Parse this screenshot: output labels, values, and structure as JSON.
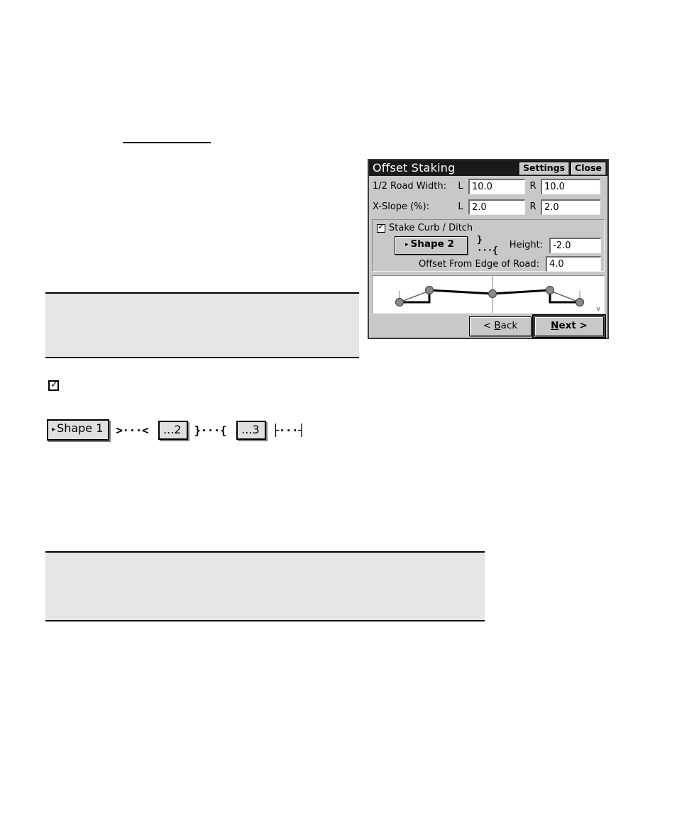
{
  "page": {
    "background": "#ffffff",
    "callout_bg": "#e5e5e5"
  },
  "document_body": {
    "top_underline": "",
    "standalone_checkbox": {
      "name": "checkbox-glyph",
      "checked": true,
      "tick": "✓"
    },
    "callout_one": "",
    "callout_two": "",
    "shape_strip": {
      "items": [
        {
          "kind": "button",
          "caret": "▸",
          "label": "Shape 1"
        },
        {
          "kind": "glyph",
          "label": ">···<"
        },
        {
          "kind": "button",
          "caret": "",
          "label": "...2"
        },
        {
          "kind": "glyph",
          "label": "}···{"
        },
        {
          "kind": "button",
          "caret": "",
          "label": "...3"
        },
        {
          "kind": "glyph",
          "label": "├···┤"
        }
      ]
    }
  },
  "dialog": {
    "title": "Offset Staking",
    "title_buttons": {
      "settings": "Settings",
      "close": "Close"
    },
    "fields": {
      "half_road_width": {
        "label": "1/2 Road Width:",
        "left_tag": "L",
        "left_value": "10.0",
        "right_tag": "R",
        "right_value": "10.0"
      },
      "x_slope": {
        "label": "X-Slope (%):",
        "left_tag": "L",
        "left_value": "2.0",
        "right_tag": "R",
        "right_value": "2.0"
      }
    },
    "curb_group": {
      "checkbox_label": "Stake Curb / Ditch",
      "checkbox_checked": true,
      "checkbox_tick": "✓",
      "shape_button": {
        "caret": "▸",
        "label": "Shape 2"
      },
      "shape_glyph": "}···{",
      "height_label": "Height:",
      "height_value": "-2.0",
      "offset_label": "Offset From Edge of Road:",
      "offset_value": "4.0"
    },
    "preview": {
      "name": "road-cross-section-preview",
      "corner_mark": "v",
      "node_color": "#808080",
      "line_color": "#000000"
    },
    "footer": {
      "back_pre": "< ",
      "back_accel": "B",
      "back_post": "ack",
      "next_accel": "N",
      "next_post": "ext >"
    }
  }
}
